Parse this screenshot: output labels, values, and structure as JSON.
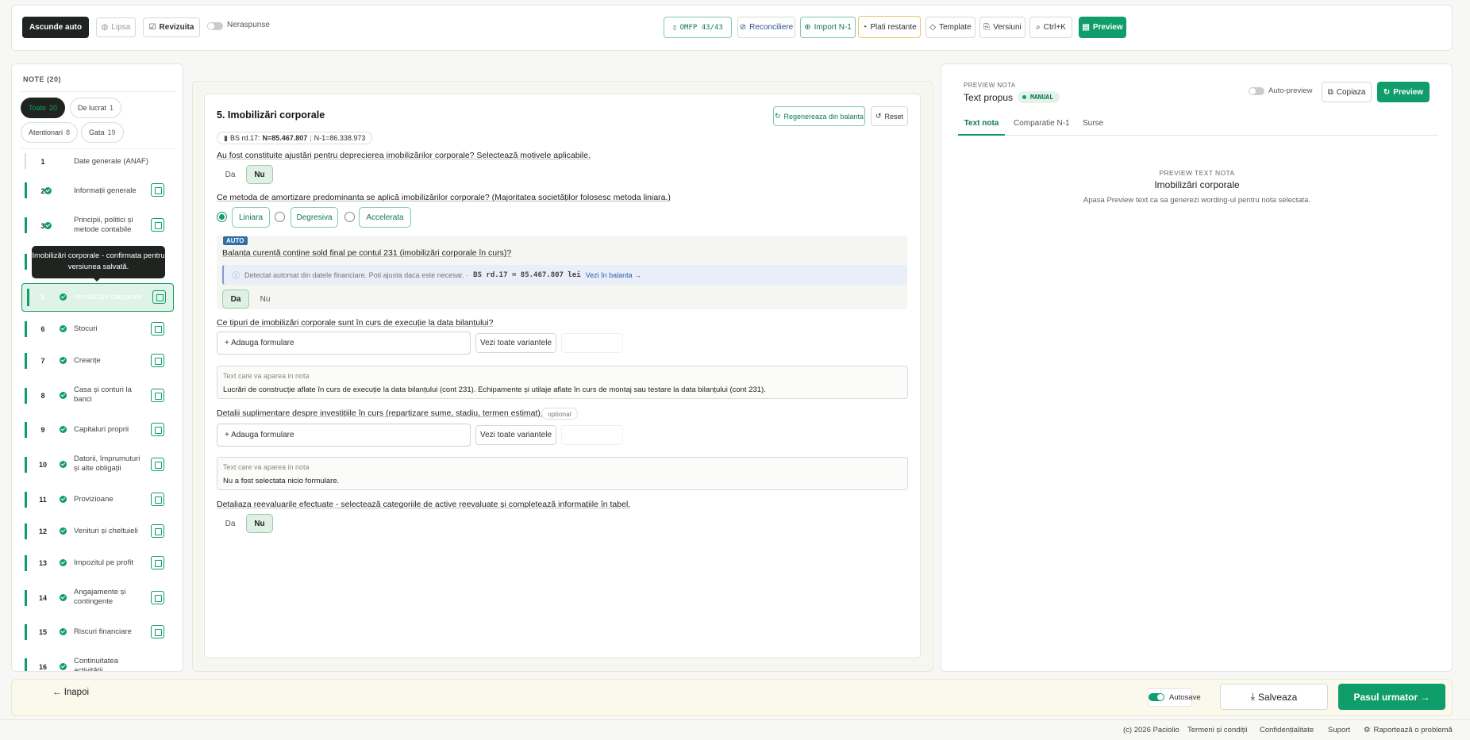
{
  "colors": {
    "accent": "#0f9d6b",
    "dark": "#1f2421",
    "highlight": "#e8c766",
    "auto_badge": "#2f6fa8"
  },
  "toolbar": {
    "hide_auto": "Ascunde auto",
    "missing": "Lipsa",
    "reviewed": "Revizuita",
    "unanswered": "Neraspunse",
    "omfp": "OMFP 43/43",
    "reconcile": "Reconciliere",
    "import": "Import N-1",
    "pending_payments": "Plati restante",
    "template": "Template",
    "versions": "Versiuni",
    "search": "Ctrl+K",
    "preview": "Preview"
  },
  "sidebar": {
    "title": "NOTE (20)",
    "filters": [
      {
        "label": "Toate",
        "count": "20"
      },
      {
        "label": "De lucrat",
        "count": "1"
      },
      {
        "label": "Atentionari",
        "count": "8"
      },
      {
        "label": "Gata",
        "count": "19"
      }
    ],
    "tooltip": "Imobilizări corporale - confirmata pentru versiunea salvată.",
    "notes": [
      {
        "num": "1",
        "label": "Date generale (ANAF)"
      },
      {
        "num": "2",
        "label": "Informații generale"
      },
      {
        "num": "3",
        "label": "Principii, politici și metode contabile"
      },
      {
        "num": "5",
        "label": "Imobilizări corporale"
      },
      {
        "num": "6",
        "label": "Stocuri"
      },
      {
        "num": "7",
        "label": "Creanțe"
      },
      {
        "num": "8",
        "label": "Casa și conturi la banci"
      },
      {
        "num": "9",
        "label": "Capitaluri proprii"
      },
      {
        "num": "10",
        "label": "Datorii, împrumuturi și alte obligații"
      },
      {
        "num": "11",
        "label": "Provizioane"
      },
      {
        "num": "12",
        "label": "Venituri și cheltuieli"
      },
      {
        "num": "13",
        "label": "Impozitul pe profit"
      },
      {
        "num": "14",
        "label": "Angajamente și contingente"
      },
      {
        "num": "15",
        "label": "Riscuri financiare"
      },
      {
        "num": "16",
        "label": "Continuitatea activității"
      }
    ]
  },
  "editor": {
    "title": "5. Imobilizări corporale",
    "regenerate": "Regenereaza din balanta",
    "reset": "Reset",
    "bs_label": "BS rd.17:",
    "bs_value": "N=85.467.807",
    "bs_prev": "N-1=86.338.973",
    "q1": "Au fost constituite ajustări pentru deprecierea imobilizărilor corporale? Selectează motivele aplicabile.",
    "yes": "Da",
    "no": "Nu",
    "q2": "Ce metoda de amortizare predominanta se aplică imobilizărilor corporale? (Majoritatea societăților folosesc metoda liniara.)",
    "methods": [
      "Liniara",
      "Degresiva",
      "Accelerata"
    ],
    "auto_badge": "AUTO",
    "q3": "Balanța curentă conține sold final pe contul 231 (imobilizări corporale în curs)?",
    "auto_info": "Detectat automat din datele financiare. Poti ajusta daca este necesar. ·",
    "auto_code": "BS rd.17 = 85.467.807 lei",
    "auto_link": "Vezi în balanta →",
    "q4": "Ce tipuri de imobilizări corporale sunt în curs de execuție la data bilanțului?",
    "add_formulation": "+ Adauga formulare",
    "see_variants": "Vezi toate variantele",
    "text_label": "Text care va aparea in nota",
    "text1": "Lucrări de construcție aflate în curs de execuție la data bilanțului (cont 231). Echipamente și utilaje aflate în curs de montaj sau testare la data bilanțului (cont 231).",
    "q5": "Detalii suplimentare despre investițiile în curs (repartizare sume, stadiu, termen estimat).",
    "optional": "optional",
    "text2": "Nu a fost selectata nicio formulare.",
    "q6": "Detaliaza reevaluarile efectuate - selectează categoriile de active reevaluate și completează informațiile în tabel."
  },
  "preview": {
    "kicker": "PREVIEW NOTA",
    "title": "Text propus",
    "badge": "MANUAL",
    "auto_preview": "Auto-preview",
    "copy": "Copiaza",
    "preview_btn": "Preview",
    "tabs": [
      "Text nota",
      "Comparatie N-1",
      "Surse"
    ],
    "empty_kicker": "PREVIEW TEXT NOTA",
    "empty_title": "Imobilizări corporale",
    "empty_hint": "Apasa Preview text ca sa generezi wording-ul pentru nota selectata."
  },
  "bottom": {
    "back": "← Inapoi",
    "autosave": "Autosave",
    "save": "Salveaza",
    "next": "Pasul urmator →"
  },
  "footer": {
    "copyright": "(c) 2026 Paciolio",
    "terms": "Termeni și condiții",
    "privacy": "Confidențialitate",
    "support": "Suport",
    "report": "Raportează o problemă"
  },
  "icons": [
    "eye-icon",
    "check-icon",
    "file-icon",
    "refresh-icon",
    "upload-icon",
    "clock-icon",
    "template-icon",
    "versions-icon",
    "search-icon",
    "chart-icon",
    "info-icon",
    "copy-icon",
    "save-icon"
  ]
}
